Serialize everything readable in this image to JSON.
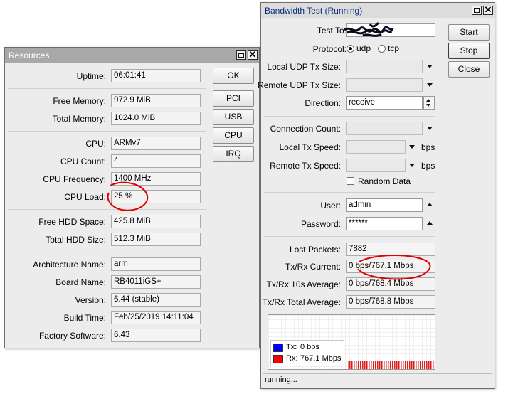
{
  "resources": {
    "title": "Resources",
    "fields": [
      {
        "label": "Uptime:",
        "value": "06:01:41"
      },
      {
        "label": "Free Memory:",
        "value": "972.9 MiB"
      },
      {
        "label": "Total Memory:",
        "value": "1024.0 MiB"
      },
      {
        "label": "CPU:",
        "value": "ARMv7"
      },
      {
        "label": "CPU Count:",
        "value": "4"
      },
      {
        "label": "CPU Frequency:",
        "value": "1400 MHz"
      },
      {
        "label": "CPU Load:",
        "value": "25 %"
      },
      {
        "label": "Free HDD Space:",
        "value": "425.8 MiB"
      },
      {
        "label": "Total HDD Size:",
        "value": "512.3 MiB"
      },
      {
        "label": "Architecture Name:",
        "value": "arm"
      },
      {
        "label": "Board Name:",
        "value": "RB4011iGS+"
      },
      {
        "label": "Version:",
        "value": "6.44 (stable)"
      },
      {
        "label": "Build Time:",
        "value": "Feb/25/2019 14:11:04"
      },
      {
        "label": "Factory Software:",
        "value": "6.43"
      }
    ],
    "buttons": [
      "OK",
      "PCI",
      "USB",
      "CPU",
      "IRQ"
    ]
  },
  "bwtest": {
    "title": "Bandwidth Test (Running)",
    "buttons": {
      "start": "Start",
      "stop": "Stop",
      "close": "Close"
    },
    "test_to_label": "Test To:",
    "test_to_value": "",
    "protocol_label": "Protocol:",
    "protocol_options": [
      "udp",
      "tcp"
    ],
    "protocol_selected": "udp",
    "local_udp_tx_label": "Local UDP Tx Size:",
    "remote_udp_tx_label": "Remote UDP Tx Size:",
    "direction_label": "Direction:",
    "direction_value": "receive",
    "connection_count_label": "Connection Count:",
    "local_tx_speed_label": "Local Tx Speed:",
    "remote_tx_speed_label": "Remote Tx Speed:",
    "speed_unit": "bps",
    "random_data_label": "Random Data",
    "user_label": "User:",
    "user_value": "admin",
    "password_label": "Password:",
    "password_value": "******",
    "lost_packets_label": "Lost Packets:",
    "lost_packets_value": "7882",
    "txrx_current_label": "Tx/Rx Current:",
    "txrx_current_value": "0 bps/767.1 Mbps",
    "txrx_10s_label": "Tx/Rx 10s Average:",
    "txrx_10s_value": "0 bps/768.4 Mbps",
    "txrx_total_label": "Tx/Rx Total Average:",
    "txrx_total_value": "0 bps/768.8 Mbps",
    "legend": {
      "tx_label": "Tx:",
      "tx_value": "0 bps",
      "tx_color": "#0000ff",
      "rx_label": "Rx:",
      "rx_value": "767.1 Mbps",
      "rx_color": "#ff0000"
    },
    "status": "running..."
  }
}
